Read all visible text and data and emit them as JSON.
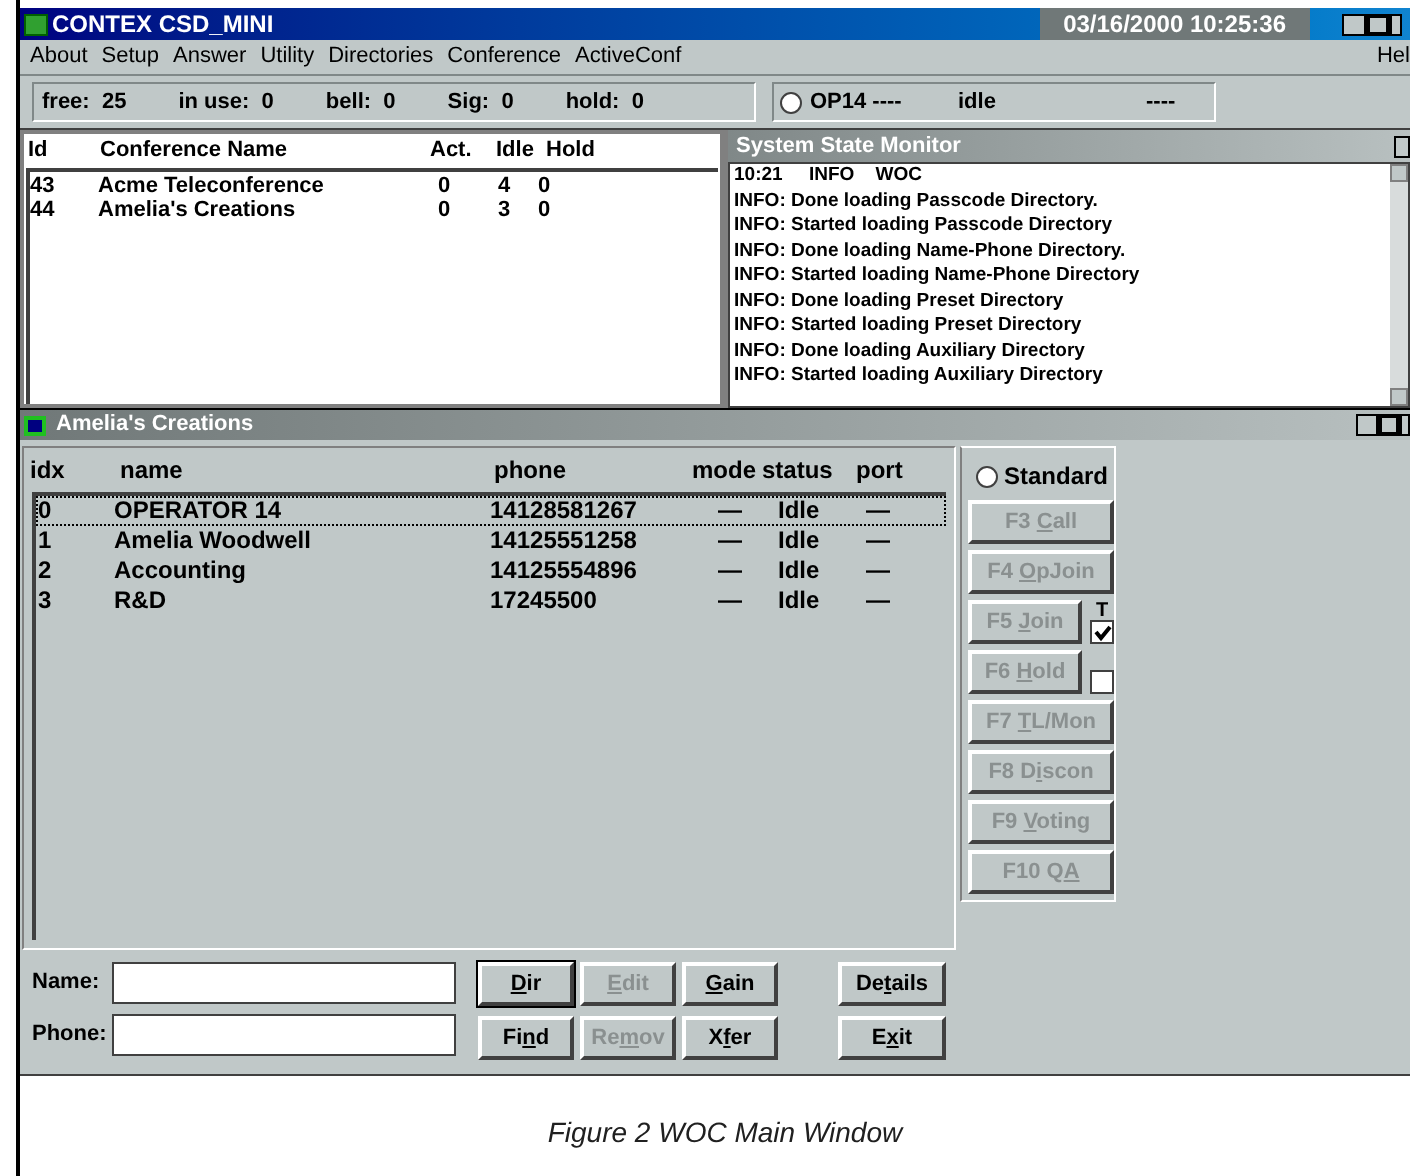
{
  "window": {
    "title": "CONTEX CSD_MINI",
    "datetime": "03/16/2000 10:25:36"
  },
  "menu": [
    "About",
    "Setup",
    "Answer",
    "Utility",
    "Directories",
    "Conference",
    "ActiveConf"
  ],
  "menu_right": "Hel",
  "counters": [
    {
      "label": "free:",
      "value": "25"
    },
    {
      "label": "in use:",
      "value": "0"
    },
    {
      "label": "bell:",
      "value": "0"
    },
    {
      "label": "Sig:",
      "value": "0"
    },
    {
      "label": "hold:",
      "value": "0"
    }
  ],
  "operator": {
    "label": "OP14 ----",
    "selected": false,
    "state": "idle",
    "extra": "----"
  },
  "conferences": {
    "columns": [
      "Id",
      "Conference Name",
      "Act.",
      "Idle",
      "Hold"
    ],
    "rows": [
      [
        "43",
        "Acme Teleconference",
        "0",
        "4",
        "0"
      ],
      [
        "44",
        "Amelia's Creations",
        "0",
        "3",
        "0"
      ]
    ]
  },
  "monitor": {
    "title": "System State Monitor",
    "lines": [
      "10:21     INFO    WOC",
      "INFO: Done loading Passcode Directory.",
      "INFO: Started loading Passcode Directory",
      "INFO: Done loading Name-Phone Directory.",
      "INFO: Started loading Name-Phone Directory",
      "INFO: Done loading Preset Directory",
      "INFO: Started loading Preset Directory",
      "INFO: Done loading Auxiliary Directory",
      "INFO: Started loading Auxiliary Directory"
    ]
  },
  "conference_window": {
    "title": "Amelia's Creations",
    "columns": [
      "idx",
      "name",
      "phone",
      "mode",
      "status",
      "port"
    ],
    "rows": [
      {
        "cells": [
          "0",
          "OPERATOR 14",
          "14128581267",
          "—",
          "Idle",
          "—"
        ],
        "selected": true
      },
      {
        "cells": [
          "1",
          "Amelia Woodwell",
          "14125551258",
          "—",
          "Idle",
          "—"
        ],
        "selected": false
      },
      {
        "cells": [
          "2",
          "Accounting",
          "14125554896",
          "—",
          "Idle",
          "—"
        ],
        "selected": false
      },
      {
        "cells": [
          "3",
          "R&D",
          "17245500",
          "—",
          "Idle",
          "—"
        ],
        "selected": false
      }
    ]
  },
  "mode_radio": {
    "label": "Standard",
    "selected": false
  },
  "function_buttons": [
    {
      "pre": "F3 ",
      "key": "C",
      "post": "all",
      "disabled": true
    },
    {
      "pre": "F4 ",
      "key": "O",
      "post": "pJoin",
      "disabled": true
    },
    {
      "pre": "F5 ",
      "key": "J",
      "post": "oin",
      "disabled": true,
      "checkbox": {
        "label": "T",
        "checked": true
      }
    },
    {
      "pre": "F6 ",
      "key": "H",
      "post": "old",
      "disabled": true,
      "checkbox": {
        "checked": false
      }
    },
    {
      "pre": "F7 ",
      "key": "T",
      "post": "L/Mon",
      "disabled": true
    },
    {
      "pre": "F8 D",
      "key": "i",
      "post": "scon",
      "disabled": true
    },
    {
      "pre": "F9 ",
      "key": "V",
      "post": "oting",
      "disabled": true
    },
    {
      "pre": "F10 Q",
      "key": "A",
      "disabled": true
    }
  ],
  "fields": [
    {
      "label": "Name:"
    },
    {
      "label": "Phone:"
    }
  ],
  "action_buttons": [
    [
      {
        "key": "D",
        "post": "ir",
        "disabled": false,
        "default": true
      },
      {
        "key": "E",
        "post": "dit",
        "disabled": true,
        "default": false
      },
      {
        "key": "G",
        "post": "ain",
        "disabled": false,
        "default": false
      },
      {
        "pre": "De",
        "key": "t",
        "post": "ails",
        "disabled": false,
        "default": false
      }
    ],
    [
      {
        "pre": "Fi",
        "key": "n",
        "post": "d",
        "disabled": false,
        "default": false
      },
      {
        "pre": "Re",
        "key": "m",
        "post": "ov",
        "disabled": true,
        "default": false
      },
      {
        "pre": "X",
        "key": "f",
        "post": "er",
        "disabled": false,
        "default": false
      },
      {
        "pre": "E",
        "key": "x",
        "post": "it",
        "disabled": false,
        "default": false
      }
    ]
  ],
  "caption": "Figure 2 WOC Main Window"
}
